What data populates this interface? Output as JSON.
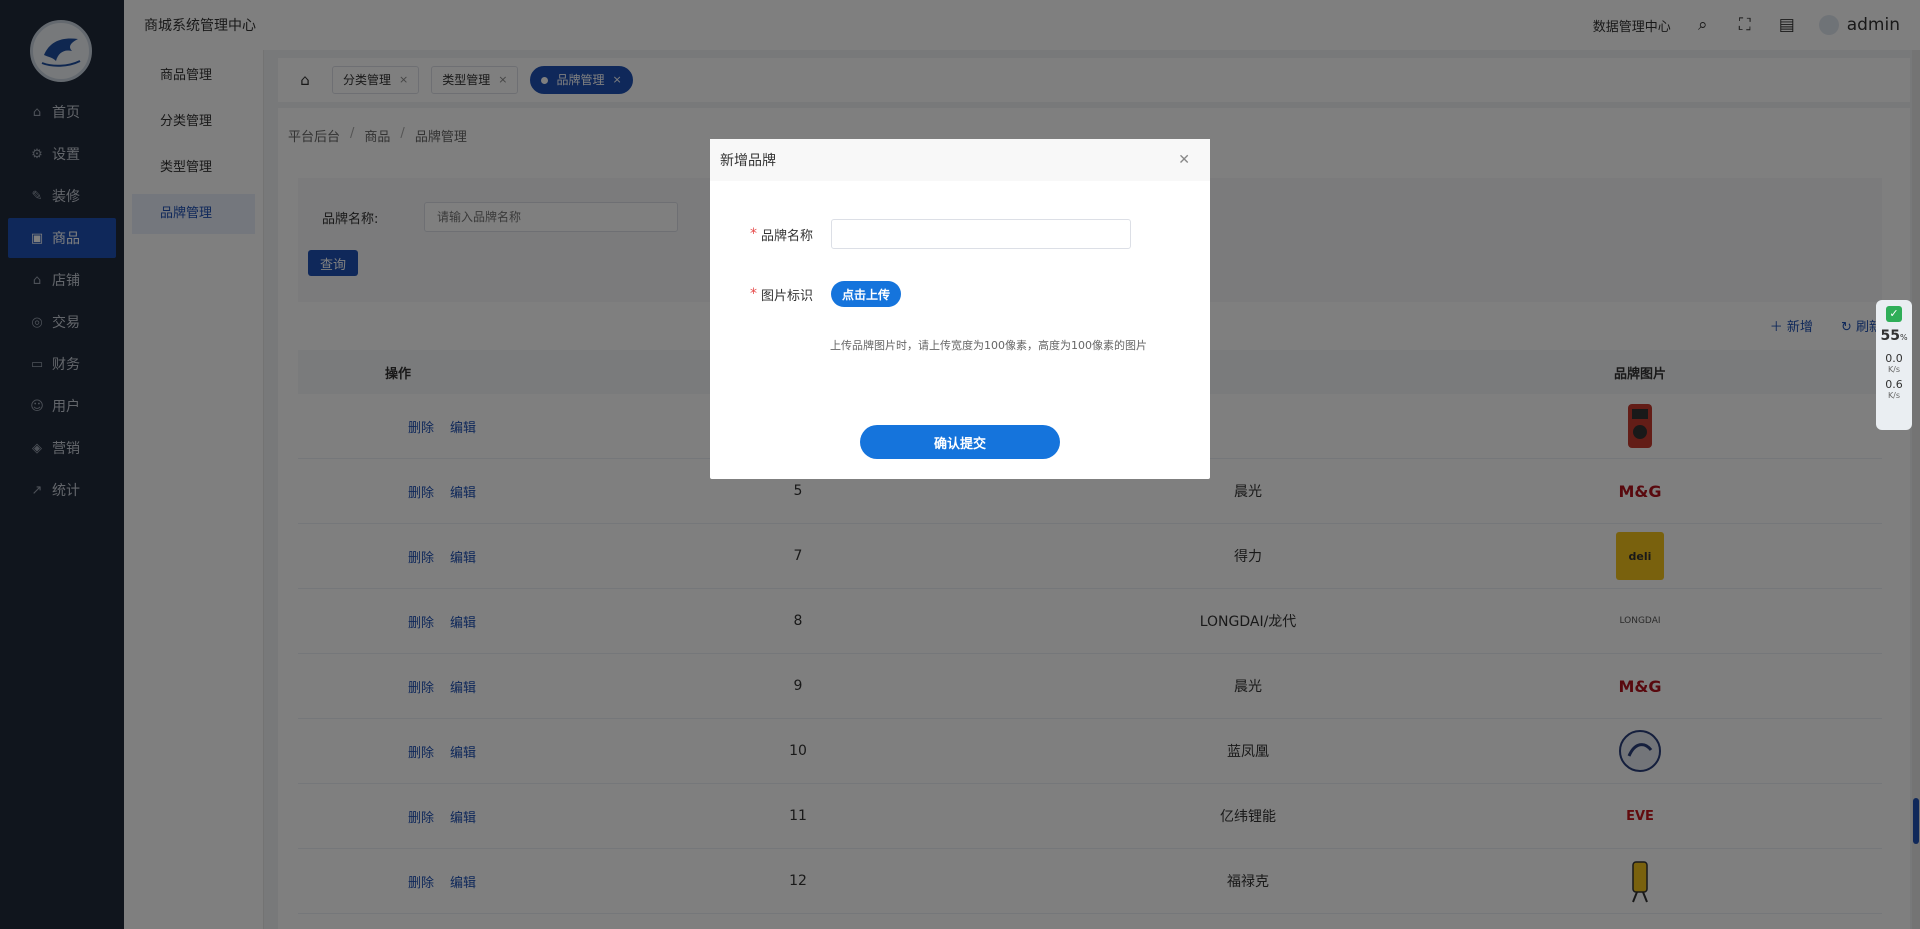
{
  "sidebar": {
    "items": [
      {
        "label": "首页",
        "icon": "home-icon",
        "active": false
      },
      {
        "label": "设置",
        "icon": "gear-icon",
        "active": false
      },
      {
        "label": "装修",
        "icon": "brush-icon",
        "active": false
      },
      {
        "label": "商品",
        "icon": "goods-icon",
        "active": true
      },
      {
        "label": "店铺",
        "icon": "shop-icon",
        "active": false
      },
      {
        "label": "交易",
        "icon": "trade-icon",
        "active": false
      },
      {
        "label": "财务",
        "icon": "wallet-icon",
        "active": false
      },
      {
        "label": "用户",
        "icon": "user-icon",
        "active": false
      },
      {
        "label": "营销",
        "icon": "tag-icon",
        "active": false
      },
      {
        "label": "统计",
        "icon": "chart-icon",
        "active": false
      }
    ]
  },
  "header": {
    "title": "商城系统管理中心",
    "data_center": "数据管理中心",
    "username": "admin"
  },
  "submenu": {
    "items": [
      {
        "label": "商品管理"
      },
      {
        "label": "分类管理"
      },
      {
        "label": "类型管理"
      },
      {
        "label": "品牌管理"
      }
    ]
  },
  "tabs": [
    {
      "label": "分类管理"
    },
    {
      "label": "类型管理"
    },
    {
      "label": "品牌管理"
    }
  ],
  "breadcrumb": [
    "平台后台",
    "商品",
    "品牌管理"
  ],
  "search": {
    "label": "品牌名称:",
    "placeholder": "请输入品牌名称",
    "button": "查询"
  },
  "toolbar": {
    "add": "新增",
    "refresh": "刷新"
  },
  "table": {
    "headers": [
      "操作",
      "",
      "",
      "品牌图片"
    ],
    "delete_label": "删除",
    "edit_label": "编辑",
    "rows": [
      {
        "id": "",
        "name": "",
        "logo": "meter"
      },
      {
        "id": "5",
        "name": "晨光",
        "logo": "mg"
      },
      {
        "id": "7",
        "name": "得力",
        "logo": "deli"
      },
      {
        "id": "8",
        "name": "LONGDAI/龙代",
        "logo": "longdai"
      },
      {
        "id": "9",
        "name": "晨光",
        "logo": "mg"
      },
      {
        "id": "10",
        "name": "蓝凤凰",
        "logo": "phoenix"
      },
      {
        "id": "11",
        "name": "亿纬锂能",
        "logo": "eve"
      },
      {
        "id": "12",
        "name": "福禄克",
        "logo": "fluke"
      }
    ]
  },
  "dialog": {
    "title": "新增品牌",
    "brand_name_label": "品牌名称",
    "image_label": "图片标识",
    "upload_button": "点击上传",
    "hint": "上传品牌图片时，请上传宽度为100像素，高度为100像素的图片",
    "submit_button": "确认提交"
  },
  "widget": {
    "percent": "55",
    "percent_unit": "%",
    "up_speed": "0.0",
    "down_speed": "0.6",
    "speed_unit": "K/s"
  },
  "colors": {
    "primary": "#1e50b4",
    "sidebar_bg": "#202a3a",
    "button_blue": "#1574dc"
  }
}
